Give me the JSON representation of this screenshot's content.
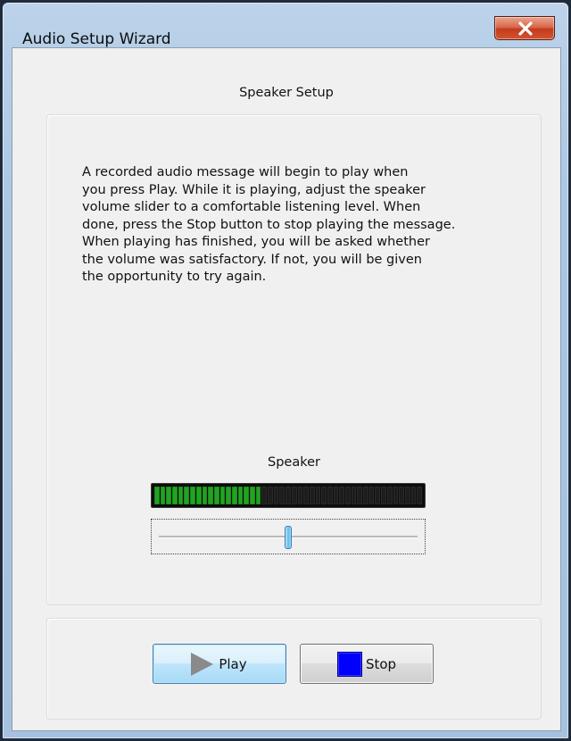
{
  "window": {
    "title": "Audio Setup Wizard"
  },
  "heading": "Speaker Setup",
  "instructions": "A recorded audio message will begin to play when\nyou press Play.  While it is playing, adjust the speaker\nvolume slider to a comfortable listening level.  When\ndone, press the Stop button to stop playing the message.\nWhen playing has finished, you will be asked whether\nthe volume was satisfactory.  If not, you will be given\nthe opportunity to try again.",
  "speaker": {
    "label": "Speaker",
    "meter_segments_total": 45,
    "meter_segments_lit": 18,
    "volume_fraction": 0.5
  },
  "buttons": {
    "play_label": "Play",
    "stop_label": "Stop"
  },
  "icons": {
    "close": "close-x-icon",
    "play": "play-triangle-icon",
    "stop": "stop-square-icon"
  },
  "colors": {
    "meter_on": "#22a322",
    "meter_off": "#1d1d1d",
    "stop_icon": "#0000ff",
    "play_icon": "#8a8a8a",
    "close_button": "#c23d1d"
  }
}
